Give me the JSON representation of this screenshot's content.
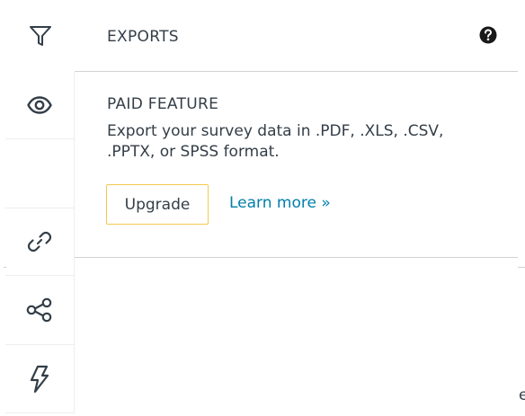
{
  "header": {
    "title": "EXPORTS",
    "help_icon": "question-circle-icon"
  },
  "sidebar": {
    "items": [
      {
        "name": "filter",
        "icon": "filter-icon"
      },
      {
        "name": "view",
        "icon": "eye-icon"
      },
      {
        "name": "blank",
        "icon": ""
      },
      {
        "name": "link",
        "icon": "link-icon"
      },
      {
        "name": "share",
        "icon": "share-icon"
      },
      {
        "name": "bolt",
        "icon": "lightning-bolt-icon"
      }
    ]
  },
  "feature": {
    "title": "PAID FEATURE",
    "description": "Export your survey data in .PDF, .XLS, .CSV, .PPTX, or SPSS format.",
    "upgrade_label": "Upgrade",
    "learn_more_label": "Learn more »"
  },
  "clipped_text": "e",
  "colors": {
    "text": "#333e48",
    "link": "#007faa",
    "button_border": "#f2c94c",
    "divider": "#d0d2d3"
  }
}
